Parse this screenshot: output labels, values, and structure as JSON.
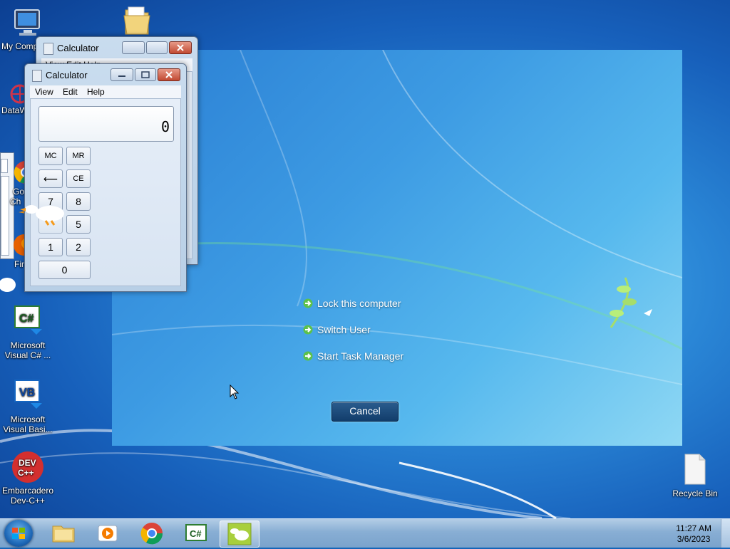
{
  "desktop": {
    "icons": [
      {
        "label": "My Comp",
        "icon": "computer-icon"
      },
      {
        "label": "DataW",
        "icon": "datawindow-icon"
      },
      {
        "label": "Go",
        "label2": "Ch",
        "icon": "chrome-icon"
      },
      {
        "label": "Fir",
        "icon": "firefox-icon"
      },
      {
        "label": "Microsoft",
        "label2": "Visual C# ...",
        "icon": "visual-csharp-icon"
      },
      {
        "label": "Microsoft",
        "label2": "Visual Basi...",
        "icon": "visual-basic-icon"
      },
      {
        "label": "Embarcadero",
        "label2": "Dev-C++",
        "icon": "devcpp-icon"
      },
      {
        "label": "Recycle Bin",
        "icon": "recycle-bin-icon"
      }
    ],
    "devcpp_logo_text": "DEV C++"
  },
  "lock_screen": {
    "options": [
      "Lock this computer",
      "Switch User",
      "Start Task Manager"
    ],
    "cancel_label": "Cancel",
    "accent_color": "#3d9be3"
  },
  "calculator_back": {
    "title": "Calculator",
    "menu_partial": "View  Edit  Help"
  },
  "calculator_front": {
    "title": "Calculator",
    "menu": [
      "View",
      "Edit",
      "Help"
    ],
    "display_value": "0",
    "buttons": {
      "mc": "MC",
      "mr": "MR",
      "back": "⟵",
      "ce": "CE",
      "n7": "7",
      "n8": "8",
      "n5": "5",
      "n1": "1",
      "n2": "2",
      "n0": "0"
    }
  },
  "taskbar": {
    "time": "11:27 AM",
    "date": "3/6/2023",
    "items": [
      "windows-explorer",
      "media-player",
      "google-chrome",
      "visual-csharp",
      "desktop-goose"
    ]
  }
}
